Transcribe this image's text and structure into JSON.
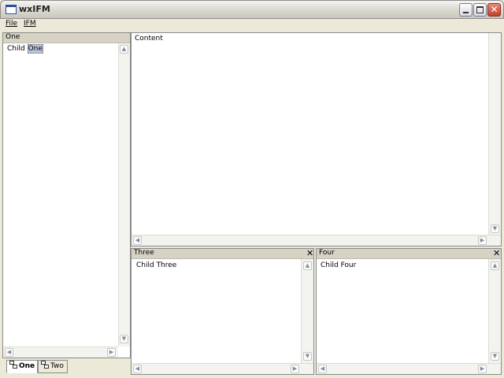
{
  "window": {
    "title": "wxIFM"
  },
  "menu": {
    "items": [
      "File",
      "IFM"
    ]
  },
  "panes": {
    "one": {
      "caption": "One",
      "tree_item_prefix": "Child ",
      "tree_item_selected": "One"
    },
    "content": {
      "caption": "Content"
    },
    "three": {
      "caption": "Three",
      "tree_item": "Child Three"
    },
    "four": {
      "caption": "Four",
      "tree_item": "Child Four"
    }
  },
  "tabs": [
    {
      "label": "One",
      "active": true
    },
    {
      "label": "Two",
      "active": false
    }
  ],
  "icons": {
    "pane_close": "close-icon",
    "tab": "tree-icon"
  },
  "colors": {
    "caption_bg": "#d6d3c5",
    "selection": "#b9c5dc",
    "window_bg": "#ece9d8"
  }
}
